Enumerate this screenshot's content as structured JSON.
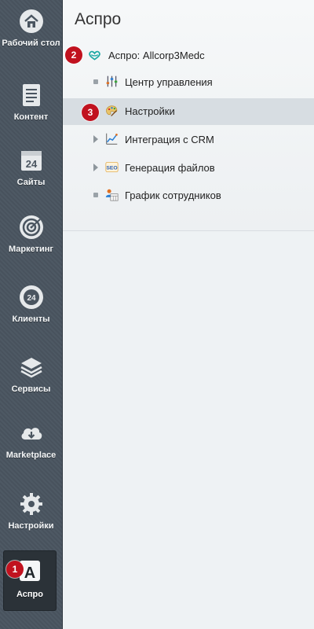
{
  "sidebar": {
    "items": [
      {
        "label": "Рабочий стол",
        "icon": "home-icon"
      },
      {
        "label": "Контент",
        "icon": "document-icon"
      },
      {
        "label": "Сайты",
        "icon": "calendar-24-icon"
      },
      {
        "label": "Маркетинг",
        "icon": "target-icon"
      },
      {
        "label": "Клиенты",
        "icon": "clients-24-icon"
      },
      {
        "label": "Сервисы",
        "icon": "layers-icon"
      },
      {
        "label": "Marketplace",
        "icon": "cloud-download-icon"
      },
      {
        "label": "Настройки",
        "icon": "gear-icon"
      },
      {
        "label": "Аспро",
        "icon": "aspro-a-icon"
      }
    ],
    "active_badge": "1"
  },
  "main": {
    "title": "Аспро",
    "root": {
      "label": "Аспро: Allcorp3Medc",
      "badge": "2",
      "icon": "aspro-heart-logo-icon"
    },
    "children": [
      {
        "label": "Центр управления",
        "type": "leaf",
        "icon": "control-sliders-icon"
      },
      {
        "label": "Настройки",
        "type": "leaf",
        "icon": "palette-icon",
        "badge": "3",
        "selected": true
      },
      {
        "label": "Интеграция с CRM",
        "type": "expandable",
        "icon": "chart-icon"
      },
      {
        "label": "Генерация файлов",
        "type": "expandable",
        "icon": "seo-icon"
      },
      {
        "label": "График сотрудников",
        "type": "leaf",
        "icon": "schedule-icon"
      }
    ]
  },
  "colors": {
    "badge": "#c1121f",
    "sidebar_bg": "#4a5560",
    "accent_logo": "#1fa9a5"
  }
}
